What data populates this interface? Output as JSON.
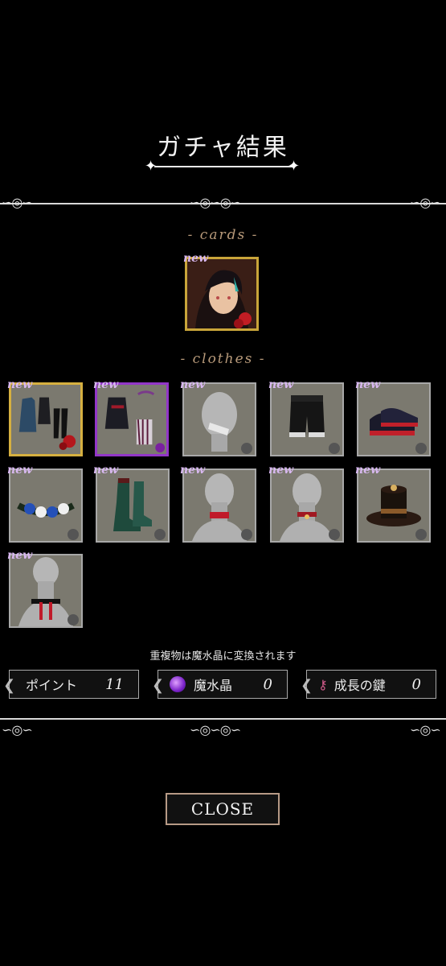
{
  "header": {
    "title": "ガチャ結果"
  },
  "sections": {
    "cards_label": "- cards -",
    "clothes_label": "- clothes -"
  },
  "badge": {
    "new": "new"
  },
  "card": {
    "is_new": true,
    "frame": "gold"
  },
  "clothes": [
    {
      "item": "dress-outfit",
      "is_new": true,
      "frame": "gold"
    },
    {
      "item": "gothic-jacket",
      "is_new": true,
      "frame": "purple"
    },
    {
      "item": "face-mask",
      "is_new": true,
      "frame": "silver"
    },
    {
      "item": "black-shorts",
      "is_new": true,
      "frame": "silver"
    },
    {
      "item": "red-sneakers",
      "is_new": true,
      "frame": "silver"
    },
    {
      "item": "flower-crown",
      "is_new": true,
      "frame": "silver"
    },
    {
      "item": "green-boots",
      "is_new": true,
      "frame": "silver"
    },
    {
      "item": "red-choker",
      "is_new": true,
      "frame": "silver"
    },
    {
      "item": "red-collar",
      "is_new": true,
      "frame": "silver"
    },
    {
      "item": "brown-hat",
      "is_new": true,
      "frame": "silver"
    },
    {
      "item": "tassel-necklace",
      "is_new": true,
      "frame": "silver"
    }
  ],
  "note": "重複物は魔水晶に変換されます",
  "counters": {
    "points": {
      "label": "ポイント",
      "value": "11"
    },
    "crystal": {
      "label": "魔水晶",
      "value": "0"
    },
    "key": {
      "label": "成長の鍵",
      "value": "0"
    }
  },
  "close_button": "CLOSE"
}
